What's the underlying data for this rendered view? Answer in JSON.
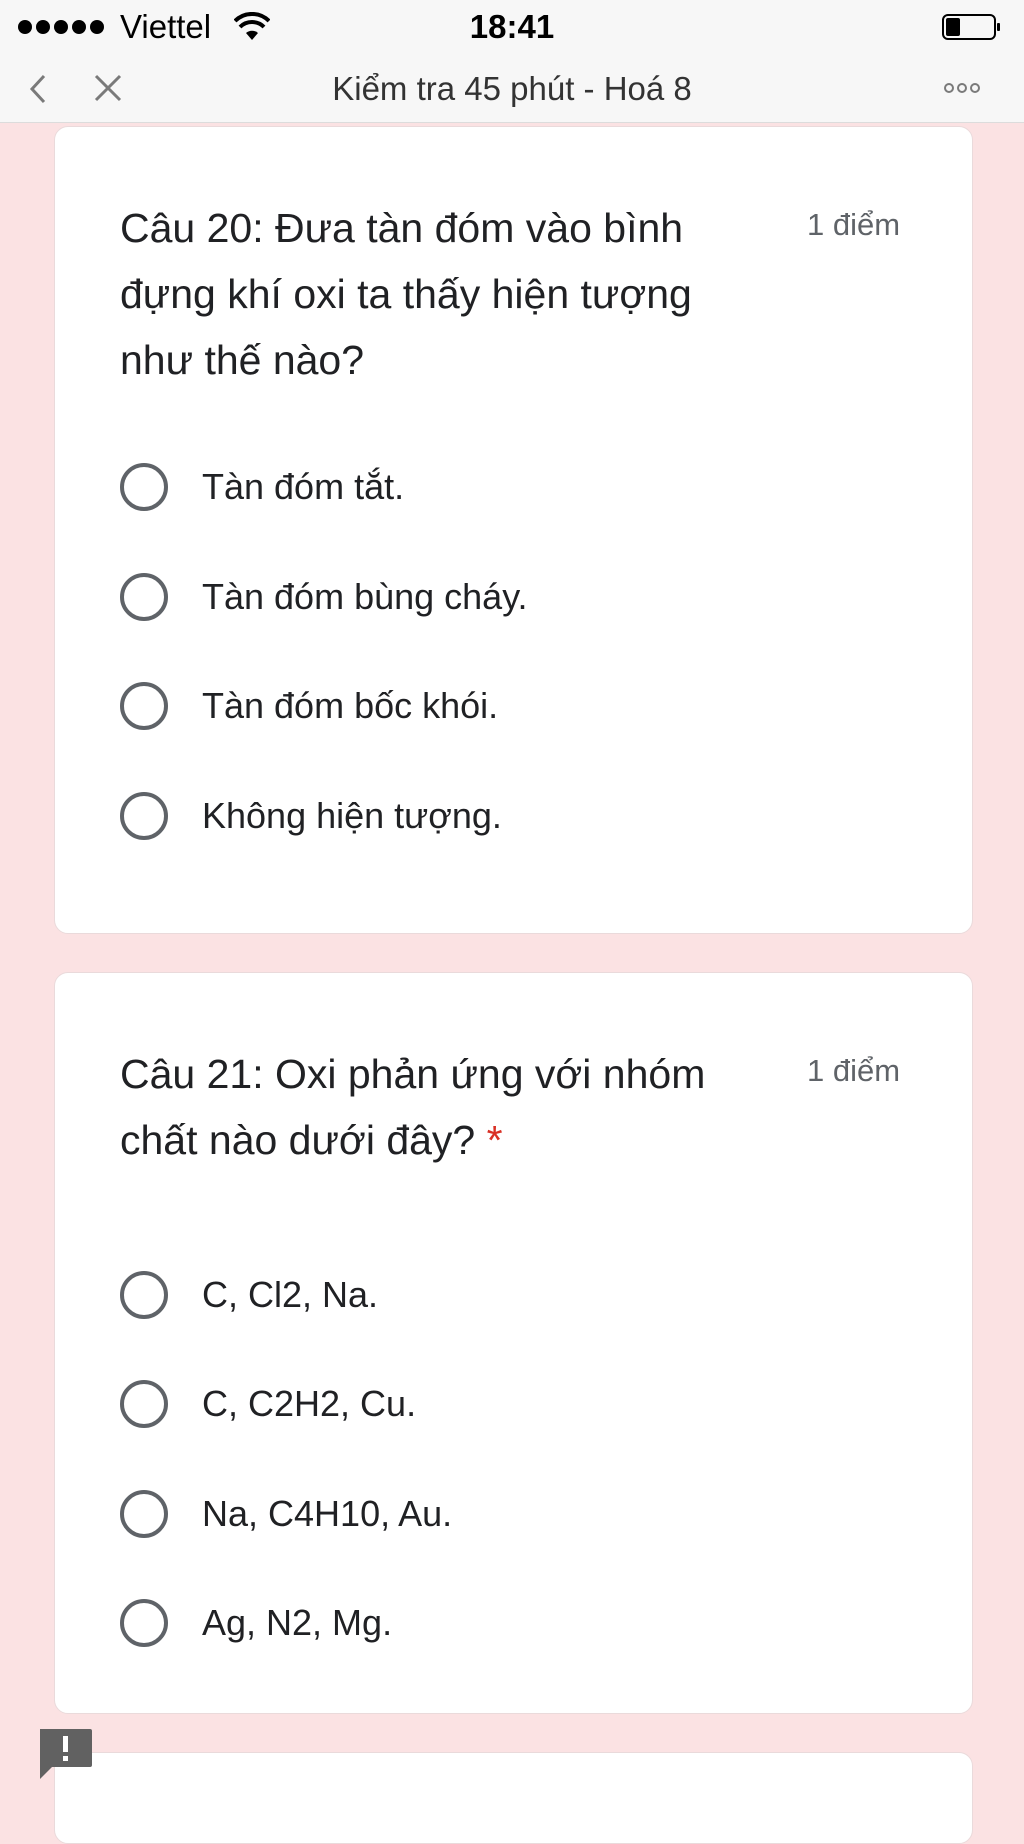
{
  "status_bar": {
    "carrier": "Viettel",
    "time": "18:41"
  },
  "nav": {
    "title": "Kiểm tra 45 phút - Hoá 8"
  },
  "questions": [
    {
      "title": "Câu 20: Đưa tàn đóm vào bình đựng khí oxi ta thấy hiện tượng như thế nào?",
      "points": "1 điểm",
      "required_mark": "",
      "options": [
        "Tàn đóm tắt.",
        "Tàn đóm bùng cháy.",
        "Tàn đóm bốc khói.",
        "Không hiện tượng."
      ]
    },
    {
      "title": "Câu 21: Oxi phản ứng với nhóm chất nào dưới đây?",
      "points": "1 điểm",
      "required_mark": "*",
      "options": [
        "C, Cl2, Na.",
        "C, C2H2, Cu.",
        "Na, C4H10, Au.",
        "Ag, N2, Mg."
      ]
    }
  ],
  "colors": {
    "background": "#fbe2e3",
    "required": "#d93025",
    "radio_border": "#5f6368"
  }
}
